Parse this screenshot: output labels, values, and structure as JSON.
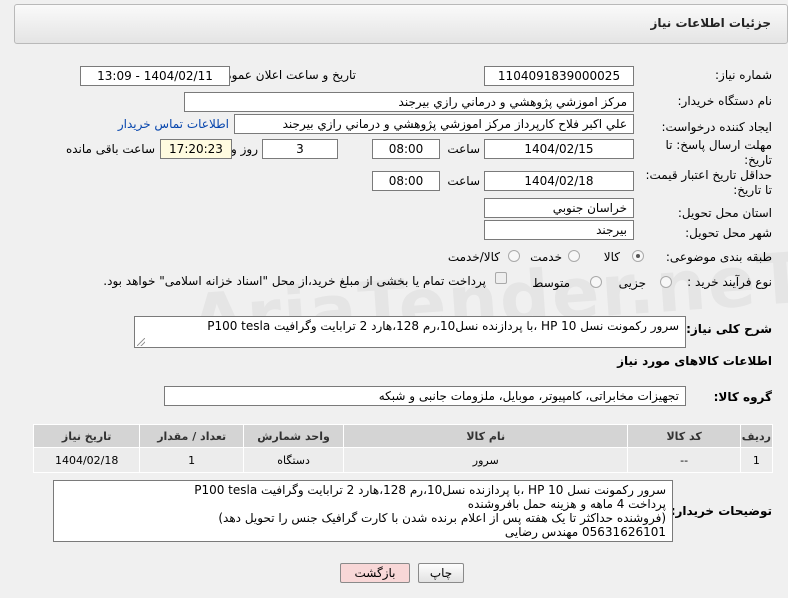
{
  "header": {
    "title": "جزئیات اطلاعات نیاز"
  },
  "fields": {
    "need_number_label": "شماره نیاز:",
    "need_number": "1104091839000025",
    "announce_label": "تاریخ و ساعت اعلان عمومی:",
    "announce_value": "1404/02/11 - 13:09",
    "buyer_org_label": "نام دستگاه خریدار:",
    "buyer_org": "مرکز اموزشي پژوهشي و درماني رازي بيرجند",
    "requester_label": "ایجاد کننده درخواست:",
    "requester": "علي اکبر فلاح کارپرداز مرکز اموزشي پژوهشي و درماني رازي بيرجند",
    "contact_link": "اطلاعات تماس خریدار",
    "deadline_label_1": "مهلت ارسال پاسخ: تا",
    "deadline_label_2": "تاریخ:",
    "deadline_date": "1404/02/15",
    "time_label": "ساعت",
    "deadline_time": "08:00",
    "days_value": "3",
    "days_label": "روز و",
    "remaining_time": "17:20:23",
    "remaining_label": "ساعت باقی مانده",
    "validity_label_1": "حداقل تاریخ اعتبار قیمت:",
    "validity_label_2": "تا تاریخ:",
    "validity_date": "1404/02/18",
    "validity_time": "08:00",
    "province_label": "استان محل تحویل:",
    "province": "خراسان جنوبي",
    "city_label": "شهر محل تحویل:",
    "city": "بيرجند",
    "category_label": "طبقه بندی موضوعی:",
    "category_options": [
      "کالا",
      "خدمت",
      "کالا/خدمت"
    ],
    "process_label": "نوع فرآیند خرید :",
    "process_options": [
      "جزیی",
      "متوسط"
    ],
    "payment_note": "پرداخت تمام یا بخشی از مبلغ خرید،از محل \"اسناد خزانه اسلامی\" خواهد بود.",
    "general_desc_label": "شرح کلی نیاز:",
    "general_desc": "سرور رکمونت نسل HP 10 ،با پردازنده نسل10،رم 128،هارد 2 ترابایت وگرافیت P100 tesla",
    "goods_info_title": "اطلاعات کالاهای مورد نیاز",
    "goods_group_label": "گروه کالا:",
    "goods_group": "تجهیزات مخابراتی، کامپیوتر، موبایل، ملزومات جانبی و شبکه"
  },
  "table": {
    "headers": [
      "ردیف",
      "کد کالا",
      "نام کالا",
      "واحد شمارش",
      "تعداد / مقدار",
      "تاریخ نیاز"
    ],
    "rows": [
      [
        "1",
        "--",
        "سرور",
        "دستگاه",
        "1",
        "1404/02/18"
      ]
    ]
  },
  "buyer_notes": {
    "label": "توضیحات خریدار:",
    "lines": [
      "سرور رکمونت نسل HP 10 ،با پردازنده نسل10،رم 128،هارد 2 ترابایت وگرافیت  P100 tesla",
      "پرداخت 4 ماهه و  هزینه حمل بافروشنده",
      "(فروشنده حداکثر تا یک هفته پس از اعلام برنده شدن با کارت گرافیک جنس را تحویل دهد)",
      "05631626101 مهندس رضایی"
    ]
  },
  "buttons": {
    "print": "چاپ",
    "back": "بازگشت"
  },
  "colors": {
    "back_button": "#f8d7d7",
    "link": "#0645ad"
  }
}
